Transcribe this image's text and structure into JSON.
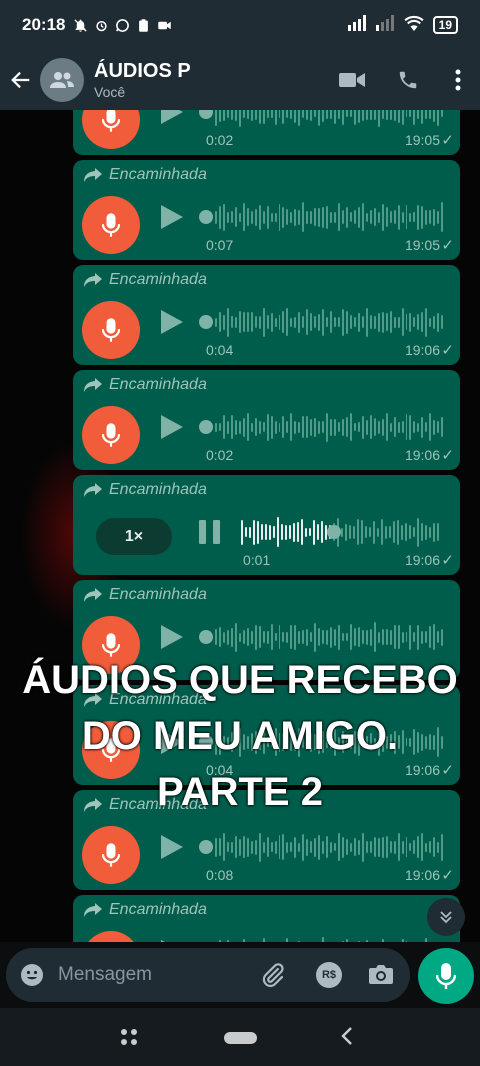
{
  "status_bar": {
    "time": "20:18",
    "battery": "19",
    "left_icons": [
      "notifications-off-icon",
      "alarm-icon",
      "whatsapp-icon",
      "clipboard-icon",
      "video-record-icon"
    ],
    "right_icons": [
      "signal-icon",
      "signal-weak-icon",
      "wifi-icon",
      "battery-icon"
    ]
  },
  "header": {
    "title": "ÁUDIOS P",
    "subtitle": "Você",
    "actions": [
      "video-call-icon",
      "voice-call-icon",
      "more-options-icon"
    ]
  },
  "messages": [
    {
      "forwarded": false,
      "forwarded_label": "",
      "duration": "0:02",
      "time": "19:05",
      "state": "idle"
    },
    {
      "forwarded": true,
      "forwarded_label": "Encaminhada",
      "duration": "0:07",
      "time": "19:05",
      "state": "idle"
    },
    {
      "forwarded": true,
      "forwarded_label": "Encaminhada",
      "duration": "0:04",
      "time": "19:06",
      "state": "idle"
    },
    {
      "forwarded": true,
      "forwarded_label": "Encaminhada",
      "duration": "0:02",
      "time": "19:06",
      "state": "idle"
    },
    {
      "forwarded": true,
      "forwarded_label": "Encaminhada",
      "duration": "0:01",
      "time": "19:06",
      "state": "playing",
      "speed": "1×",
      "progress": 0.46
    },
    {
      "forwarded": true,
      "forwarded_label": "Encaminhada",
      "duration": "",
      "time": "",
      "state": "idle"
    },
    {
      "forwarded": true,
      "forwarded_label": "Encaminhada",
      "duration": "0:04",
      "time": "19:06",
      "state": "idle"
    },
    {
      "forwarded": true,
      "forwarded_label": "Encaminhada",
      "duration": "0:08",
      "time": "19:06",
      "state": "idle"
    },
    {
      "forwarded": true,
      "forwarded_label": "Encaminhada",
      "duration": "",
      "time": "",
      "state": "idle"
    }
  ],
  "overlay_text": {
    "line1": "ÁUDIOS QUE RECEBO",
    "line2": "DO MEU AMIGO.",
    "line3": "PARTE 2"
  },
  "input": {
    "placeholder": "Mensagem",
    "pay_label": "R$"
  },
  "colors": {
    "bubble": "#005c4b",
    "mic_avatar": "#f15c3b",
    "send_button": "#00a884",
    "header": "#1f2c34"
  }
}
